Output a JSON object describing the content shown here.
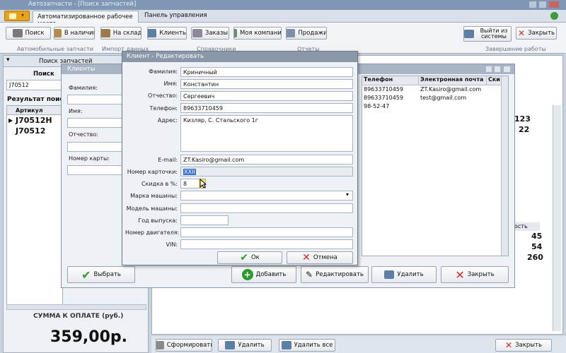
{
  "app": {
    "title": "Автозапчасти - [Поиск запчастей]",
    "tabs": [
      "Автоматизированное рабочее место",
      "Панель управления"
    ]
  },
  "ribbon": {
    "buttons": [
      "Поиск",
      "В наличии",
      "На склад",
      "Клиенты",
      "Заказы",
      "Моя компания",
      "Продажи",
      "Выйти из системы",
      "Закрыть"
    ],
    "groups": [
      "Автомобильные запчасти",
      "Импорт данных",
      "Справочники",
      "Отчеты",
      "Завершение работы"
    ]
  },
  "left_panel": {
    "tab": "Поиск запчастей",
    "search_label": "Поиск",
    "search_value": "J70512",
    "result_title": "Результат поиска",
    "col_article": "Артикул",
    "rows": [
      "J70512H",
      "J70512"
    ],
    "sum_label": "СУММА К ОПЛАТЕ (руб.)",
    "sum_value": "359,00р."
  },
  "right_grid": {
    "values_top": [
      "123",
      "22"
    ],
    "col_qty": "ость",
    "values_bottom": [
      "45",
      "54",
      "260"
    ]
  },
  "bottom_bar": {
    "buttons": [
      "Сформировать",
      "Удалить",
      "Удалить все",
      "Закрыть"
    ]
  },
  "clients_window": {
    "title": "Клиенты",
    "labels": [
      "Фамилия:",
      "Имя:",
      "Отчество:",
      "Номер карты:"
    ],
    "select_button": "Выбрать",
    "add_button": "Добавить",
    "edit_button": "Редактировать",
    "delete_button": "Удалить",
    "close_button": "Закрыть",
    "headers": [
      "Телефон",
      "Электронная почта",
      "Ски"
    ],
    "rows": [
      {
        "phone": "89633710459",
        "email": "ZT.Kasiro@gmail.com"
      },
      {
        "phone": "89633710459",
        "email": "test@gmail.com"
      },
      {
        "phone": "98-52-47",
        "email": ""
      }
    ]
  },
  "edit_dialog": {
    "title": "Клиент - Редактировать",
    "fields": [
      {
        "label": "Фамилия:",
        "value": "Криничный"
      },
      {
        "label": "Имя:",
        "value": "Константин"
      },
      {
        "label": "Отчество:",
        "value": "Сергеевич"
      },
      {
        "label": "Телефон:",
        "value": "89633710459"
      },
      {
        "label": "Адрес:",
        "value": "Кизляр, С. Стальского 1г"
      },
      {
        "label": "E-mail:",
        "value": "ZT.Kasiro@gmail.com"
      },
      {
        "label": "Номер карточки:",
        "value": "XXII"
      },
      {
        "label": "Скидка в %:",
        "value": "8"
      },
      {
        "label": "Марка машины:",
        "value": ""
      },
      {
        "label": "Модель машины:",
        "value": ""
      },
      {
        "label": "Год выпуска:",
        "value": ""
      },
      {
        "label": "Номер двигателя:",
        "value": ""
      },
      {
        "label": "VIN:",
        "value": ""
      }
    ],
    "ok": "Ок",
    "cancel": "Отмена"
  },
  "colors": {
    "titlebar": "#7f96b4",
    "dialog_caption": "#8a97a8",
    "accent": "#e8a317",
    "check_green": "#2e9a2e",
    "cross_red": "#d22a2a"
  }
}
